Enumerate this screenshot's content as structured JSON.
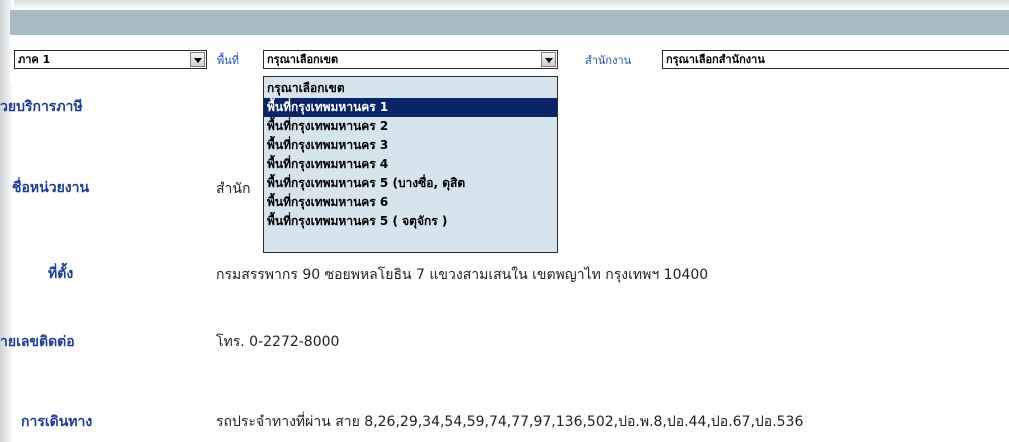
{
  "filters": {
    "region_value": "ภาค 1",
    "area_label": "พื้นที่",
    "area_value": "กรุณาเลือกเขต",
    "office_label": "สำนักงาน",
    "office_value": "กรุณาเลือกสำนักงาน"
  },
  "area_dropdown": {
    "options": [
      "กรุณาเลือกเขต",
      "พื้นที่กรุงเทพมหานคร 1",
      "พื้นที่กรุงเทพมหานคร 2",
      "พื้นที่กรุงเทพมหานคร 3",
      "พื้นที่กรุงเทพมหานคร 4",
      "พื้นที่กรุงเทพมหานคร 5 (บางซื่อ, ดุสิต",
      "พื้นที่กรุงเทพมหานคร 6",
      "พื้นที่กรุงเทพมหานคร 5 ( จตุจักร )"
    ],
    "selected_index": 1
  },
  "details": {
    "service_label": "วยบริการภาษี",
    "name_label": "ชื่อหน่วยงาน",
    "name_value": "สำนัก",
    "location_label": "ที่ตั้ง",
    "location_value": "กรมสรรพากร 90 ซอยพหลโยธิน 7 แขวงสามเสนใน เขตพญาไท กรุงเทพฯ 10400",
    "contact_label": "ายเลขติดต่อ",
    "contact_value": "โทร. 0-2272-8000",
    "travel_label": "การเดินทาง",
    "travel_value": "รถประจำทางที่ผ่าน สาย 8,26,29,34,54,59,74,77,97,136,502,ปอ.พ.8,ปอ.44,ปอ.67,ปอ.536"
  },
  "colors": {
    "header_bar": "#a9bcc6",
    "label_blue": "#1c3c9a",
    "dropdown_bg": "#d6e4ee",
    "selection": "#0a246a"
  }
}
